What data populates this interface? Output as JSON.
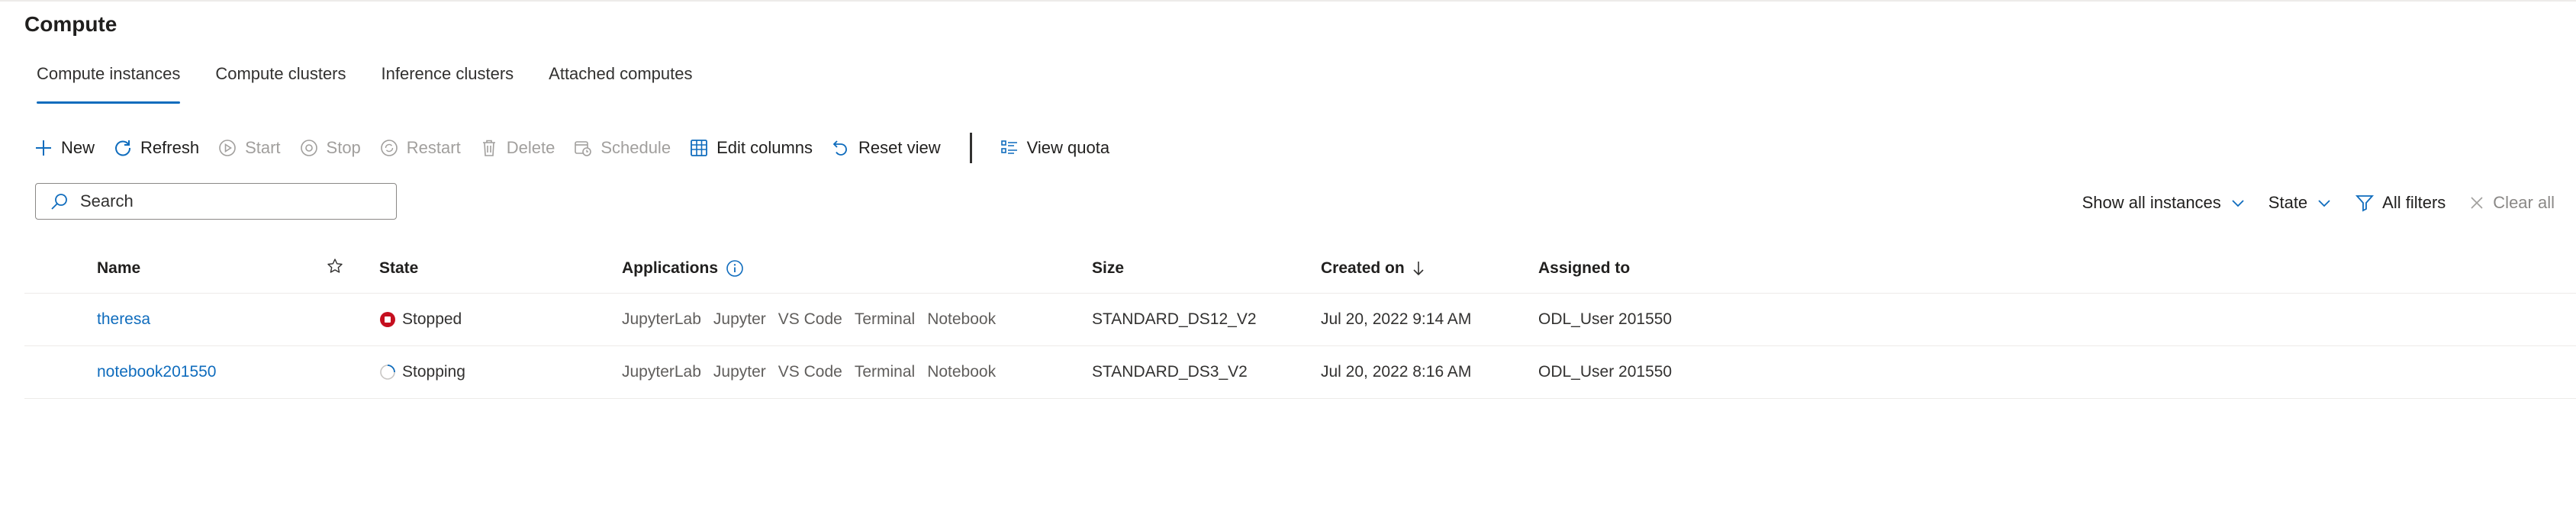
{
  "page": {
    "title": "Compute"
  },
  "tabs": [
    {
      "label": "Compute instances",
      "active": true
    },
    {
      "label": "Compute clusters"
    },
    {
      "label": "Inference clusters"
    },
    {
      "label": "Attached computes"
    }
  ],
  "toolbar": {
    "new": "New",
    "refresh": "Refresh",
    "start": "Start",
    "stop": "Stop",
    "restart": "Restart",
    "delete": "Delete",
    "schedule": "Schedule",
    "edit_columns": "Edit columns",
    "reset_view": "Reset view",
    "view_quota": "View quota"
  },
  "search": {
    "placeholder": "Search"
  },
  "filters": {
    "show_instances": "Show all instances",
    "state": "State",
    "all_filters": "All filters",
    "clear_all": "Clear all"
  },
  "table": {
    "columns": {
      "name": "Name",
      "state": "State",
      "applications": "Applications",
      "size": "Size",
      "created_on": "Created on",
      "assigned_to": "Assigned to"
    },
    "rows": [
      {
        "name": "theresa",
        "state": "Stopped",
        "state_icon": "stopped-icon",
        "apps": [
          "JupyterLab",
          "Jupyter",
          "VS Code",
          "Terminal",
          "Notebook"
        ],
        "size": "STANDARD_DS12_V2",
        "created": "Jul 20, 2022 9:14 AM",
        "assigned": "ODL_User 201550"
      },
      {
        "name": "notebook201550",
        "state": "Stopping",
        "state_icon": "spinner-icon",
        "apps": [
          "JupyterLab",
          "Jupyter",
          "VS Code",
          "Terminal",
          "Notebook"
        ],
        "size": "STANDARD_DS3_V2",
        "created": "Jul 20, 2022 8:16 AM",
        "assigned": "ODL_User 201550"
      }
    ]
  },
  "colors": {
    "accent": "#0f6cbd",
    "stopped": "#c50f1f",
    "disabled": "#a19f9d"
  }
}
